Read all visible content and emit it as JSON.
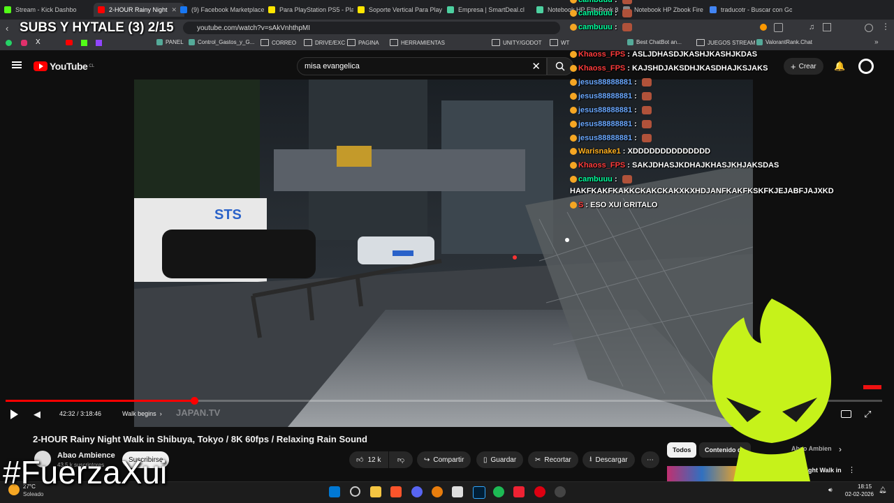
{
  "browser": {
    "tabs": [
      {
        "label": "Stream - Kick Dashbo",
        "favicon_color": "#53fc18"
      },
      {
        "label": "2-HOUR Rainy Night",
        "favicon_color": "#ff0000",
        "active": true
      },
      {
        "label": "(9) Facebook Marketplace",
        "favicon_color": "#1877f2"
      },
      {
        "label": "Para PlayStation PS5 - Play",
        "favicon_color": "#ffe600"
      },
      {
        "label": "Soporte Vertical Para Play",
        "favicon_color": "#ffe600"
      },
      {
        "label": "Empresa | SmartDeal.cl",
        "favicon_color": "#4dd0a0"
      },
      {
        "label": "Notebook HP EliteBook 8",
        "favicon_color": "#4dd0a0"
      },
      {
        "label": "Notebook HP Zbook Fire",
        "favicon_color": "#888888"
      },
      {
        "label": "traducotr - Buscar con Go",
        "favicon_color": "#4285f4"
      }
    ],
    "url": "youtube.com/watch?v=sAkVnhthpMI",
    "bookmarks": [
      "PANEL",
      "Control_Gastos_y_G...",
      "CORREO",
      "DRIVE/EXC",
      "PAGINA",
      "HERRAMIENTAS",
      "UNITY/GODOT",
      "WT",
      "Best ChatBot an...",
      "JUEGOS STREAM",
      "ValorantRank.Chat"
    ]
  },
  "stream_overlay": {
    "title": "SUBS Y HYTALE (3) 2/15",
    "hashtag": "#FuerzaXui"
  },
  "youtube": {
    "logo": "YouTube",
    "region": "CL",
    "search_value": "misa evangelica",
    "create_label": "Crear",
    "player": {
      "time": "42:32 / 3:18:46",
      "chapter": "Walk begins",
      "progress_fraction": 0.215,
      "watermark": "JAPAN.TV"
    },
    "video_title": "2-HOUR Rainy Night Walk in Shibuya, Tokyo / 8K 60fps / Relaxing Rain Sound",
    "channel": "Abao Ambience",
    "subscribers": "43,5 k suscriptores",
    "subscribe_label": "Suscribirse",
    "likes": "12 k",
    "actions": [
      "Compartir",
      "Guardar",
      "Recortar",
      "Descargar"
    ],
    "chips": [
      "Todos",
      "Contenido de",
      "Abao Ambien"
    ],
    "rec_title": "Night Walk in"
  },
  "chat": [
    {
      "user": "cambuuu",
      "text": "",
      "color": "#00ff9c"
    },
    {
      "user": "cambuuu",
      "text": "",
      "color": "#00ff9c"
    },
    {
      "user": "cambuuu",
      "text": "",
      "color": "#00ff9c"
    },
    {
      "user": "Khaoss_FPS",
      "text": "ASLJDHASDJKASHJKASHJKDAS",
      "color": "#ff3b3b"
    },
    {
      "user": "Khaoss_FPS",
      "text": "KAJSHDJAKSDHJKASDHAJKSJAKS",
      "color": "#ff3b3b"
    },
    {
      "user": "jesus88888881",
      "text": "",
      "color": "#6aa8ff"
    },
    {
      "user": "jesus88888881",
      "text": "",
      "color": "#6aa8ff"
    },
    {
      "user": "jesus88888881",
      "text": "",
      "color": "#6aa8ff"
    },
    {
      "user": "jesus88888881",
      "text": "",
      "color": "#6aa8ff"
    },
    {
      "user": "jesus88888881",
      "text": "",
      "color": "#6aa8ff"
    },
    {
      "user": "Warisnake1",
      "text": "XDDDDDDDDDDDDDD",
      "color": "#ffb020"
    },
    {
      "user": "Khaoss_FPS",
      "text": "SAKJDHASJKDHAJKHASJKHJAKSDAS",
      "color": "#ff3b3b"
    },
    {
      "user": "cambuuu",
      "text": "",
      "color": "#00ff9c"
    },
    {
      "user": "",
      "text": "HAKFKAKFKAKKCKAKCKAKXKXHDJANFKAKFKSKFKJEJABFJAJXKD",
      "color": "#ffffff"
    },
    {
      "user": "S",
      "text": "ESO XUI GRITALO",
      "color": "#ff3b3b"
    }
  ],
  "taskbar": {
    "weather_temp": "27°C",
    "weather_desc": "Soleado",
    "time": "18:15",
    "date": "02-02-2026"
  },
  "colors": {
    "youtube_red": "#ff0000",
    "mascot_green": "#c6f21a"
  }
}
